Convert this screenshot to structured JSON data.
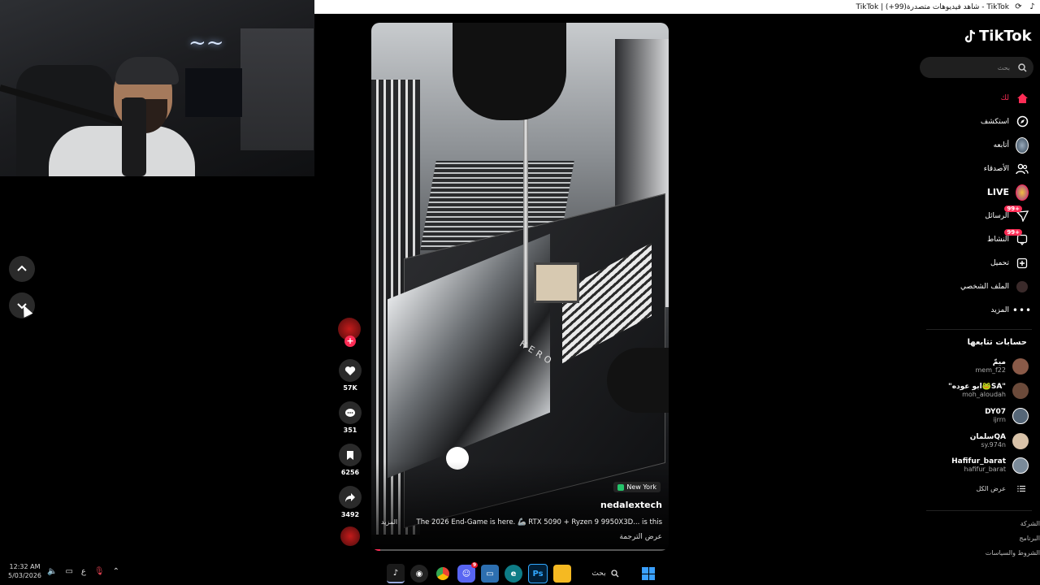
{
  "browser": {
    "tab_title": "TikTok | شاهد فيديوهات متصدرة(99+) - TikTok"
  },
  "video": {
    "location": "New York",
    "author": "nedalextech",
    "description": "The 2026 End-Game is here. 🦾 RTX 5090 + Ryzen 9 9950X3D... is this",
    "more_label": "المزيد",
    "translate_label": "عرض الترجمة",
    "board_label": "HERO",
    "progress": 0.03
  },
  "actions": {
    "likes": "57K",
    "comments": "351",
    "saves": "6256",
    "shares": "3492"
  },
  "sidebar": {
    "logo_text": "TikTok",
    "search_placeholder": "بحث",
    "menu": [
      {
        "label": "لك",
        "icon": "home-icon"
      },
      {
        "label": "استكشف",
        "icon": "compass-icon"
      },
      {
        "label": "أتابعه",
        "icon": "following-avatar-icon"
      },
      {
        "label": "الأصدقاء",
        "icon": "friends-icon"
      },
      {
        "label": "LIVE",
        "icon": "live-icon"
      },
      {
        "label": "الرسائل",
        "icon": "messages-icon",
        "badge": "99+"
      },
      {
        "label": "النشاط",
        "icon": "activity-icon",
        "badge": "99+"
      },
      {
        "label": "تحميل",
        "icon": "upload-icon"
      },
      {
        "label": "الملف الشخصي",
        "icon": "profile-icon"
      },
      {
        "label": "المزيد",
        "icon": "more-icon"
      }
    ],
    "following_title": "حسابات تتابعها",
    "accounts": [
      {
        "name": "ميمّ",
        "handle": "mem_f22",
        "color": "#8a5a48"
      },
      {
        "name": "\"ابو عوده🐸SA\"",
        "handle": "moh_aloudah",
        "color": "#6b4a3a"
      },
      {
        "name": "DY07",
        "handle": "ijrrn",
        "color": "#556677"
      },
      {
        "name": "سلمانQA",
        "handle": "sy.974n",
        "color": "#d8c2a8"
      },
      {
        "name": "Hafifur_barat",
        "handle": "hafifur_barat",
        "color": "#7a8a99"
      }
    ],
    "see_all": "عرض الكل",
    "footer": [
      "الشركة",
      "البرنامج",
      "الشروط والسياسات"
    ]
  },
  "taskbar": {
    "time": "12:32 AM",
    "date": "5/03/2026",
    "lang": "ع",
    "search_label": "بحث",
    "discord_badge": "9"
  }
}
